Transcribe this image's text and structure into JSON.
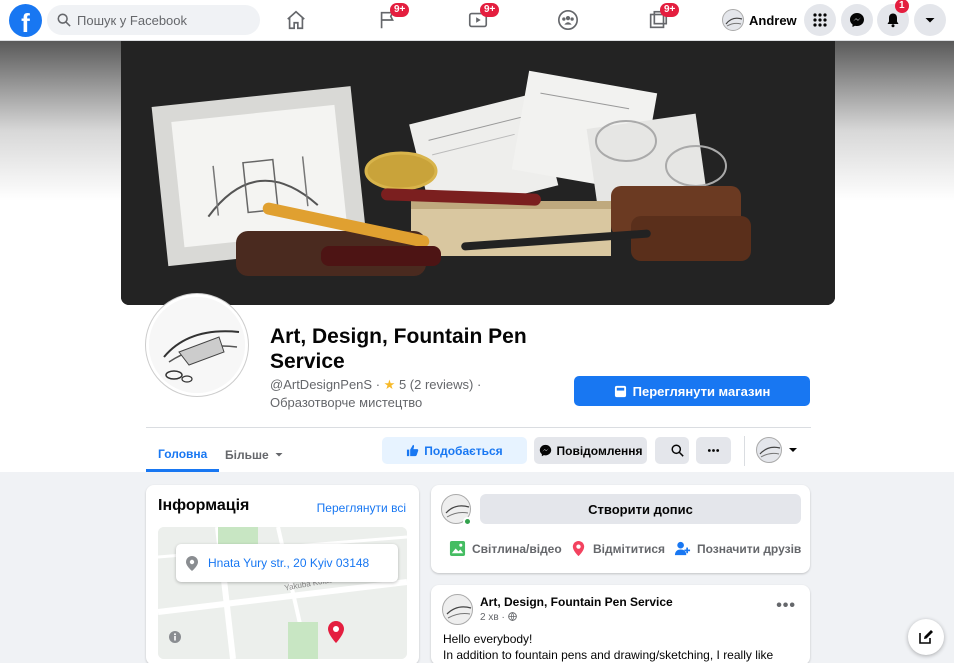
{
  "topbar": {
    "logo": "f",
    "search_placeholder": "Пошук у Facebook",
    "nav_badges": {
      "pages": "9+",
      "watch": "9+",
      "gaming": "9+"
    },
    "user_name": "Andrew",
    "notifications_badge": "1"
  },
  "page": {
    "title": "Art, Design, Fountain Pen Service",
    "handle": "@ArtDesignPenS",
    "rating": "5 (2 reviews)",
    "category": "Образотворче мистецтво",
    "shop_button": "Переглянути магазин"
  },
  "tabs": {
    "home": "Головна",
    "more": "Більше"
  },
  "actions": {
    "like": "Подобається",
    "message": "Повідомлення"
  },
  "info": {
    "title": "Інформація",
    "see_all": "Переглянути всі",
    "address": "Hnata Yury str., 20 Kyiv 03148",
    "map_street": "Yakuba Kolasa"
  },
  "composer": {
    "create_post": "Створити допис",
    "photo": "Світлина/відео",
    "checkin": "Відмітитися",
    "tag": "Позначити друзів"
  },
  "post": {
    "author": "Art, Design, Fountain Pen Service",
    "time": "2 хв",
    "line1": "Hello everybody!",
    "line2": "In addition to fountain pens and drawing/sketching, I really like"
  },
  "colors": {
    "brand": "#1877f2",
    "badge": "#e41e3f",
    "star": "#f7b928"
  }
}
